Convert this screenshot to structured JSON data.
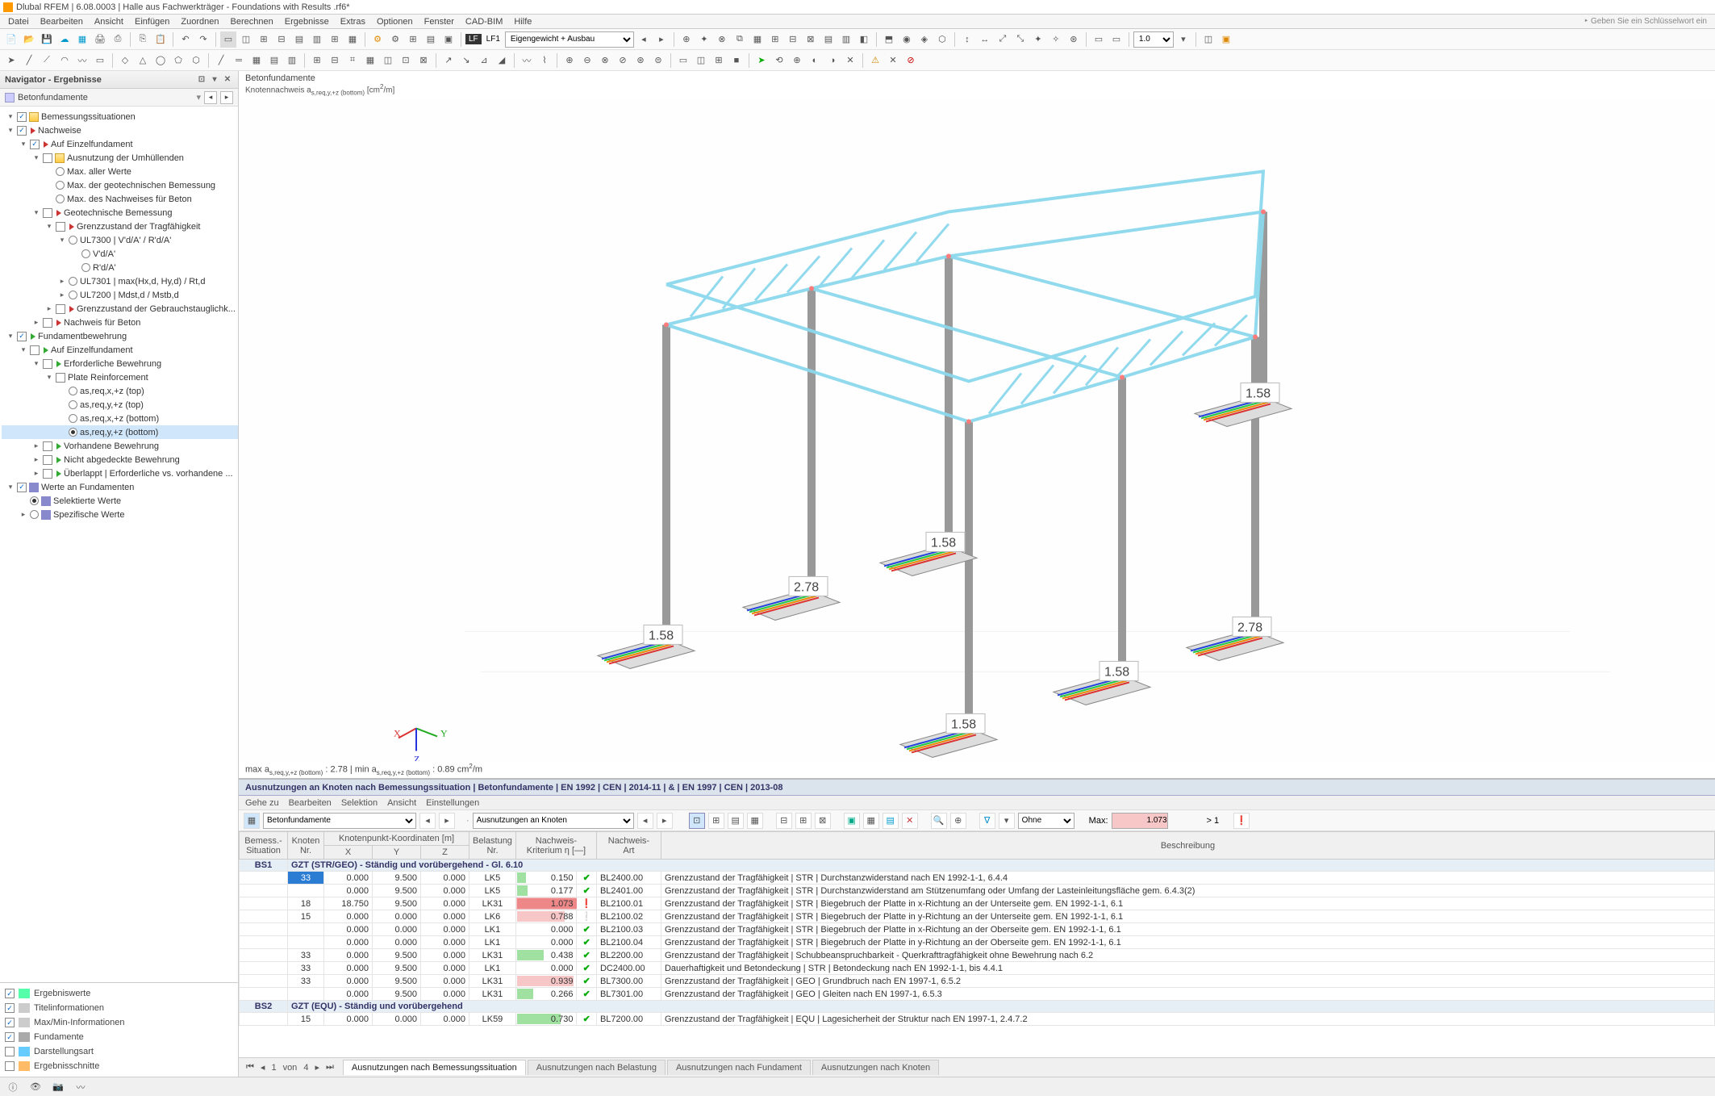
{
  "title": "Dlubal RFEM | 6.08.0003 | Halle aus Fachwerkträger - Foundations with Results .rf6*",
  "menus": [
    "Datei",
    "Bearbeiten",
    "Ansicht",
    "Einfügen",
    "Zuordnen",
    "Berechnen",
    "Ergebnisse",
    "Extras",
    "Optionen",
    "Fenster",
    "CAD-BIM",
    "Hilfe"
  ],
  "rightHint": "‣ Geben Sie ein Schlüsselwort ein",
  "lf": {
    "code": "LF1",
    "name": "Eigengewicht + Ausbau"
  },
  "navigator": {
    "title": "Navigator - Ergebnisse",
    "selector": "Betonfundamente",
    "tree": [
      {
        "ind": 6,
        "tw": "▾",
        "cb": "✓",
        "ico": "folder",
        "txt": "Bemessungssituationen"
      },
      {
        "ind": 6,
        "tw": "▾",
        "cb": "✓",
        "ico": "flag-red",
        "txt": "Nachweise"
      },
      {
        "ind": 22,
        "tw": "▾",
        "cb": "✓",
        "ico": "flag-red",
        "txt": "Auf Einzelfundament"
      },
      {
        "ind": 38,
        "tw": "▾",
        "cb": "",
        "ico": "folder",
        "txt": "Ausnutzung der Umhüllenden"
      },
      {
        "ind": 54,
        "tw": "",
        "rd": false,
        "txt": "Max. aller Werte"
      },
      {
        "ind": 54,
        "tw": "",
        "rd": false,
        "txt": "Max. der geotechnischen Bemessung"
      },
      {
        "ind": 54,
        "tw": "",
        "rd": false,
        "txt": "Max. des Nachweises für Beton"
      },
      {
        "ind": 38,
        "tw": "▾",
        "cb": "",
        "ico": "flag-red",
        "txt": "Geotechnische Bemessung"
      },
      {
        "ind": 54,
        "tw": "▾",
        "cb": "",
        "ico": "flag-red",
        "txt": "Grenzzustand der Tragfähigkeit"
      },
      {
        "ind": 70,
        "tw": "▾",
        "rd": false,
        "txt": "UL7300 | V'd/A' / R'd/A'"
      },
      {
        "ind": 86,
        "tw": "",
        "rd": false,
        "txt": "V'd/A'"
      },
      {
        "ind": 86,
        "tw": "",
        "rd": false,
        "txt": "R'd/A'"
      },
      {
        "ind": 70,
        "tw": "▸",
        "rd": false,
        "txt": "UL7301 | max(Hx,d, Hy,d) / Rt,d"
      },
      {
        "ind": 70,
        "tw": "▸",
        "rd": false,
        "txt": "UL7200 | Mdst,d / Mstb,d"
      },
      {
        "ind": 54,
        "tw": "▸",
        "cb": "",
        "ico": "flag-red",
        "txt": "Grenzzustand der Gebrauchstauglichk..."
      },
      {
        "ind": 38,
        "tw": "▸",
        "cb": "",
        "ico": "flag-red",
        "txt": "Nachweis für Beton"
      },
      {
        "ind": 6,
        "tw": "▾",
        "cb": "✓",
        "ico": "flag-grn",
        "txt": "Fundamentbewehrung"
      },
      {
        "ind": 22,
        "tw": "▾",
        "cb": "",
        "ico": "flag-grn",
        "txt": "Auf Einzelfundament"
      },
      {
        "ind": 38,
        "tw": "▾",
        "cb": "",
        "ico": "flag-grn",
        "txt": "Erforderliche Bewehrung"
      },
      {
        "ind": 54,
        "tw": "▾",
        "cb": "",
        "ico": "",
        "txt": "Plate Reinforcement"
      },
      {
        "ind": 70,
        "tw": "",
        "rd": false,
        "txt": "as,req,x,+z (top)"
      },
      {
        "ind": 70,
        "tw": "",
        "rd": false,
        "txt": "as,req,y,+z (top)"
      },
      {
        "ind": 70,
        "tw": "",
        "rd": false,
        "txt": "as,req,x,+z (bottom)"
      },
      {
        "ind": 70,
        "tw": "",
        "rd": true,
        "txt": "as,req,y,+z (bottom)",
        "sel": true
      },
      {
        "ind": 38,
        "tw": "▸",
        "cb": "",
        "ico": "flag-grn",
        "txt": "Vorhandene Bewehrung"
      },
      {
        "ind": 38,
        "tw": "▸",
        "cb": "",
        "ico": "flag-grn",
        "txt": "Nicht abgedeckte Bewehrung"
      },
      {
        "ind": 38,
        "tw": "▸",
        "cb": "",
        "ico": "flag-grn",
        "txt": "Überlappt | Erforderliche vs. vorhandene ..."
      },
      {
        "ind": 6,
        "tw": "▾",
        "cb": "✓",
        "ico": "sq",
        "txt": "Werte an Fundamenten"
      },
      {
        "ind": 22,
        "tw": "",
        "rd": true,
        "ico": "sq",
        "txt": "Selektierte Werte"
      },
      {
        "ind": 22,
        "tw": "▸",
        "rd": false,
        "ico": "sq",
        "txt": "Spezifische Werte"
      }
    ],
    "bottom": [
      {
        "chk": true,
        "color": "",
        "label": "Ergebniswerte",
        "ico": "#5fa"
      },
      {
        "chk": true,
        "color": "",
        "label": "Titelinformationen",
        "ico": "#ccc"
      },
      {
        "chk": true,
        "color": "",
        "label": "Max/Min-Informationen",
        "ico": "#ccc"
      },
      {
        "chk": true,
        "color": "",
        "label": "Fundamente",
        "ico": "#aaa"
      },
      {
        "chk": false,
        "color": "",
        "label": "Darstellungsart",
        "ico": "#6cf"
      },
      {
        "chk": false,
        "color": "",
        "label": "Ergebnisschnitte",
        "ico": "#fb6"
      }
    ]
  },
  "viewHeader": {
    "h1": "Betonfundamente",
    "h2_html": "Knotennachweis a<sub>s,req,y,+z (bottom)</sub> [cm<sup>2</sup>/m]"
  },
  "foundationValues": [
    "1.58",
    "2.78",
    "1.58",
    "1.58",
    "1.58",
    "2.78",
    "1.58"
  ],
  "axes": {
    "x": "X",
    "y": "Y",
    "z": "Z"
  },
  "footerLine_html": "max a<sub>s,req,y,+z (bottom)</sub> : 2.78 | min a<sub>s,req,y,+z (bottom)</sub> : 0.89 cm<sup>2</sup>/m",
  "resultsPanel": {
    "title": "Ausnutzungen an Knoten nach Bemessungssituation | Betonfundamente | EN 1992 | CEN | 2014-11 | & | EN 1997 | CEN | 2013-08",
    "menus": [
      "Gehe zu",
      "Bearbeiten",
      "Selektion",
      "Ansicht",
      "Einstellungen"
    ],
    "filter1": "Betonfundamente",
    "filter2": "Ausnutzungen an Knoten",
    "colorMode": "Ohne",
    "maxLabel": "Max:",
    "maxVal": "1.073",
    "maxLimit": "> 1",
    "columns": {
      "c1": "Bemess.-\nSituation",
      "c2": "Knoten\nNr.",
      "c3": "Knotenpunkt-Koordinaten [m]",
      "c3a": "X",
      "c3b": "Y",
      "c3c": "Z",
      "c4": "Belastung\nNr.",
      "c5": "Nachweis-\nKriterium η [—]",
      "c6": "Nachweis-\nArt",
      "c7": "Beschreibung"
    },
    "groups": [
      {
        "sit": "BS1",
        "label": "GZT (STR/GEO) - Ständig und vorübergehend - Gl. 6.10",
        "rows": [
          {
            "kn": "33",
            "x": "0.000",
            "y": "9.500",
            "z": "0.000",
            "lk": "LK5",
            "crit": "0.150",
            "st": "ok",
            "code": "BL2400.00",
            "desc": "Grenzzustand der Tragfähigkeit | STR | Durchstanzwiderstand nach EN 1992-1-1, 6.4.4",
            "hl": true
          },
          {
            "kn": "",
            "x": "0.000",
            "y": "9.500",
            "z": "0.000",
            "lk": "LK5",
            "crit": "0.177",
            "st": "ok",
            "code": "BL2401.00",
            "desc": "Grenzzustand der Tragfähigkeit | STR | Durchstanzwiderstand am Stützenumfang oder Umfang der Lasteinleitungsfläche gem. 6.4.3(2)"
          },
          {
            "kn": "18",
            "x": "18.750",
            "y": "9.500",
            "z": "0.000",
            "lk": "LK31",
            "crit": "1.073",
            "st": "fail",
            "code": "BL2100.01",
            "desc": "Grenzzustand der Tragfähigkeit | STR | Biegebruch der Platte in x-Richtung an der Unterseite gem. EN 1992-1-1, 6.1"
          },
          {
            "kn": "15",
            "x": "0.000",
            "y": "0.000",
            "z": "0.000",
            "lk": "LK6",
            "crit": "0.788",
            "st": "warn",
            "code": "BL2100.02",
            "desc": "Grenzzustand der Tragfähigkeit | STR | Biegebruch der Platte in y-Richtung an der Unterseite gem. EN 1992-1-1, 6.1"
          },
          {
            "kn": "",
            "x": "0.000",
            "y": "0.000",
            "z": "0.000",
            "lk": "LK1",
            "crit": "0.000",
            "st": "ok",
            "code": "BL2100.03",
            "desc": "Grenzzustand der Tragfähigkeit | STR | Biegebruch der Platte in x-Richtung an der Oberseite gem. EN 1992-1-1, 6.1"
          },
          {
            "kn": "",
            "x": "0.000",
            "y": "0.000",
            "z": "0.000",
            "lk": "LK1",
            "crit": "0.000",
            "st": "ok",
            "code": "BL2100.04",
            "desc": "Grenzzustand der Tragfähigkeit | STR | Biegebruch der Platte in y-Richtung an der Oberseite gem. EN 1992-1-1, 6.1"
          },
          {
            "kn": "33",
            "x": "0.000",
            "y": "9.500",
            "z": "0.000",
            "lk": "LK31",
            "crit": "0.438",
            "st": "ok",
            "code": "BL2200.00",
            "desc": "Grenzzustand der Tragfähigkeit | Schubbeanspruchbarkeit - Querkrafttragfähigkeit ohne Bewehrung nach 6.2"
          },
          {
            "kn": "33",
            "x": "0.000",
            "y": "9.500",
            "z": "0.000",
            "lk": "LK1",
            "crit": "0.000",
            "st": "ok",
            "code": "DC2400.00",
            "desc": "Dauerhaftigkeit und Betondeckung | STR | Betondeckung nach EN 1992-1-1, bis 4.4.1"
          },
          {
            "kn": "33",
            "x": "0.000",
            "y": "9.500",
            "z": "0.000",
            "lk": "LK31",
            "crit": "0.939",
            "st": "ok",
            "code": "BL7300.00",
            "desc": "Grenzzustand der Tragfähigkeit | GEO | Grundbruch nach EN 1997-1, 6.5.2"
          },
          {
            "kn": "",
            "x": "0.000",
            "y": "9.500",
            "z": "0.000",
            "lk": "LK31",
            "crit": "0.266",
            "st": "ok",
            "code": "BL7301.00",
            "desc": "Grenzzustand der Tragfähigkeit | GEO | Gleiten nach EN 1997-1, 6.5.3"
          }
        ]
      },
      {
        "sit": "BS2",
        "label": "GZT (EQU) - Ständig und vorübergehend",
        "rows": [
          {
            "kn": "15",
            "x": "0.000",
            "y": "0.000",
            "z": "0.000",
            "lk": "LK59",
            "crit": "0.730",
            "st": "ok",
            "code": "BL7200.00",
            "desc": "Grenzzustand der Tragfähigkeit | EQU | Lagesicherheit der Struktur nach EN 1997-1, 2.4.7.2"
          }
        ]
      }
    ],
    "pager": {
      "cur": "1",
      "total": "4",
      "text": "von"
    },
    "tabs": [
      "Ausnutzungen nach Bemessungssituation",
      "Ausnutzungen nach Belastung",
      "Ausnutzungen nach Fundament",
      "Ausnutzungen nach Knoten"
    ],
    "activeTab": 0
  }
}
